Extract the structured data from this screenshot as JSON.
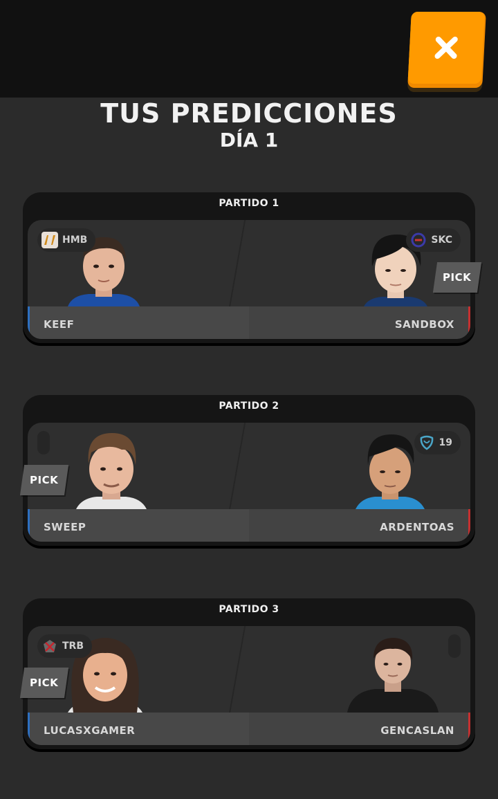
{
  "header": {
    "close_icon": "close-icon",
    "accent": "#ff9a00"
  },
  "title": "TUS PREDICCIONES",
  "subtitle": "DÍA 1",
  "pick_label": "PICK",
  "matches": [
    {
      "title": "PARTIDO 1",
      "left": {
        "team": "HMB",
        "player": "KEEF",
        "logo": "hmb-logo-icon"
      },
      "right": {
        "team": "SKC",
        "player": "SANDBOX",
        "logo": "skc-logo-icon"
      },
      "picked": "right"
    },
    {
      "title": "PARTIDO 2",
      "left": {
        "team": "",
        "player": "SWEEP",
        "logo": ""
      },
      "right": {
        "team": "19",
        "player": "ARDENTOAS",
        "logo": "nineteen-logo-icon"
      },
      "picked": "left"
    },
    {
      "title": "PARTIDO 3",
      "left": {
        "team": "TRB",
        "player": "LUCASXGAMER",
        "logo": "trb-logo-icon"
      },
      "right": {
        "team": "",
        "player": "GENCASLAN",
        "logo": ""
      },
      "picked": "left"
    }
  ]
}
